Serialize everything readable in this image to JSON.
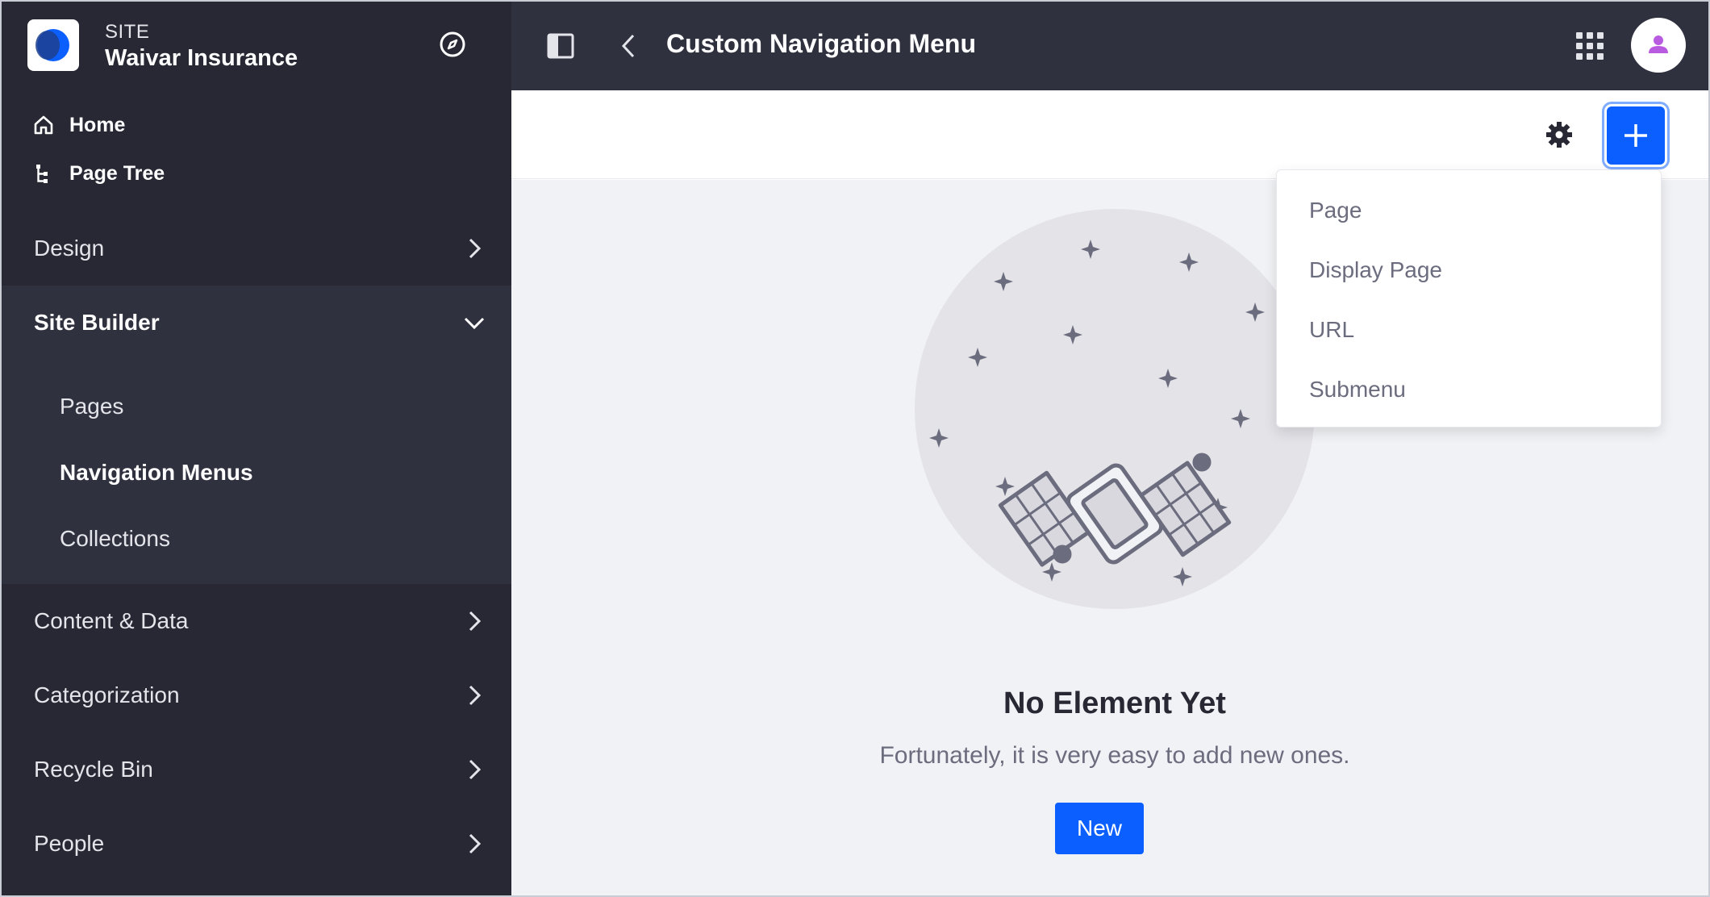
{
  "colors": {
    "sidebar_bg": "#272833",
    "panel_bg": "#30313f",
    "accent": "#0b5fff",
    "avatar_accent": "#b95be0",
    "empty_bg": "#f1f2f5"
  },
  "site": {
    "kicker": "SITE",
    "name": "Waivar Insurance",
    "logo_icon": "site-logo-icon",
    "compass_icon": "compass-icon"
  },
  "sidebar": {
    "quick_links": [
      {
        "label": "Home",
        "icon": "home-icon"
      },
      {
        "label": "Page Tree",
        "icon": "page-tree-icon"
      }
    ],
    "sections": [
      {
        "label": "Design",
        "expanded": false
      },
      {
        "label": "Site Builder",
        "expanded": true,
        "items": [
          {
            "label": "Pages",
            "active": false
          },
          {
            "label": "Navigation Menus",
            "active": true
          },
          {
            "label": "Collections",
            "active": false
          }
        ]
      },
      {
        "label": "Content & Data",
        "expanded": false
      },
      {
        "label": "Categorization",
        "expanded": false
      },
      {
        "label": "Recycle Bin",
        "expanded": false
      },
      {
        "label": "People",
        "expanded": false
      }
    ]
  },
  "header": {
    "title": "Custom Navigation Menu",
    "panel_toggle_icon": "sidebar-toggle-icon",
    "back_icon": "chevron-left-icon",
    "apps_icon": "apps-grid-icon",
    "user_icon": "user-avatar-icon"
  },
  "toolbar": {
    "settings_icon": "gear-icon",
    "add_icon": "plus-icon"
  },
  "add_menu": {
    "items": [
      "Page",
      "Display Page",
      "URL",
      "Submenu"
    ]
  },
  "empty_state": {
    "title": "No Element Yet",
    "description": "Fortunately, it is very easy to add new ones.",
    "button": "New",
    "illustration": "satellite-illustration"
  }
}
